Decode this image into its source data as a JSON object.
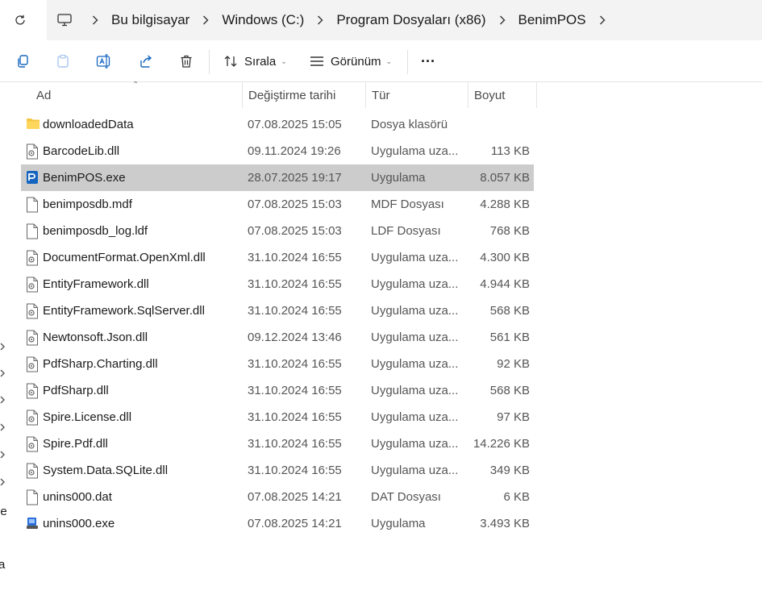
{
  "breadcrumb": {
    "items": [
      "Bu bilgisayar",
      "Windows (C:)",
      "Program Dosyaları (x86)",
      "BenimPOS"
    ]
  },
  "toolbar": {
    "sort_label": "Sırala",
    "view_label": "Görünüm",
    "more_label": "···"
  },
  "columns": {
    "name": "Ad",
    "date": "Değiştirme tarihi",
    "type": "Tür",
    "size": "Boyut"
  },
  "navpane": {
    "partial_1": "le",
    "partial_2": "a"
  },
  "files": [
    {
      "name": "downloadedData",
      "date": "07.08.2025 15:05",
      "type": "Dosya klasörü",
      "size": "",
      "icon": "folder-icon"
    },
    {
      "name": "BarcodeLib.dll",
      "date": "09.11.2024 19:26",
      "type": "Uygulama uza...",
      "size": "113 KB",
      "icon": "dll-file-icon"
    },
    {
      "name": "BenimPOS.exe",
      "date": "28.07.2025 19:17",
      "type": "Uygulama",
      "size": "8.057 KB",
      "icon": "app-exe-icon"
    },
    {
      "name": "benimposdb.mdf",
      "date": "07.08.2025 15:03",
      "type": "MDF Dosyası",
      "size": "4.288 KB",
      "icon": "file-icon"
    },
    {
      "name": "benimposdb_log.ldf",
      "date": "07.08.2025 15:03",
      "type": "LDF Dosyası",
      "size": "768 KB",
      "icon": "file-icon"
    },
    {
      "name": "DocumentFormat.OpenXml.dll",
      "date": "31.10.2024 16:55",
      "type": "Uygulama uza...",
      "size": "4.300 KB",
      "icon": "dll-file-icon"
    },
    {
      "name": "EntityFramework.dll",
      "date": "31.10.2024 16:55",
      "type": "Uygulama uza...",
      "size": "4.944 KB",
      "icon": "dll-file-icon"
    },
    {
      "name": "EntityFramework.SqlServer.dll",
      "date": "31.10.2024 16:55",
      "type": "Uygulama uza...",
      "size": "568 KB",
      "icon": "dll-file-icon"
    },
    {
      "name": "Newtonsoft.Json.dll",
      "date": "09.12.2024 13:46",
      "type": "Uygulama uza...",
      "size": "561 KB",
      "icon": "dll-file-icon"
    },
    {
      "name": "PdfSharp.Charting.dll",
      "date": "31.10.2024 16:55",
      "type": "Uygulama uza...",
      "size": "92 KB",
      "icon": "dll-file-icon"
    },
    {
      "name": "PdfSharp.dll",
      "date": "31.10.2024 16:55",
      "type": "Uygulama uza...",
      "size": "568 KB",
      "icon": "dll-file-icon"
    },
    {
      "name": "Spire.License.dll",
      "date": "31.10.2024 16:55",
      "type": "Uygulama uza...",
      "size": "97 KB",
      "icon": "dll-file-icon"
    },
    {
      "name": "Spire.Pdf.dll",
      "date": "31.10.2024 16:55",
      "type": "Uygulama uza...",
      "size": "14.226 KB",
      "icon": "dll-file-icon"
    },
    {
      "name": "System.Data.SQLite.dll",
      "date": "31.10.2024 16:55",
      "type": "Uygulama uza...",
      "size": "349 KB",
      "icon": "dll-file-icon"
    },
    {
      "name": "unins000.dat",
      "date": "07.08.2025 14:21",
      "type": "DAT Dosyası",
      "size": "6 KB",
      "icon": "file-icon"
    },
    {
      "name": "unins000.exe",
      "date": "07.08.2025 14:21",
      "type": "Uygulama",
      "size": "3.493 KB",
      "icon": "installer-exe-icon"
    }
  ],
  "selected_file": "BenimPOS.exe",
  "colors": {
    "selection": "#cccccc",
    "folder": "#f4c542",
    "app_icon": "#1565c0",
    "breadcrumb_bg": "#f3f3f3"
  }
}
